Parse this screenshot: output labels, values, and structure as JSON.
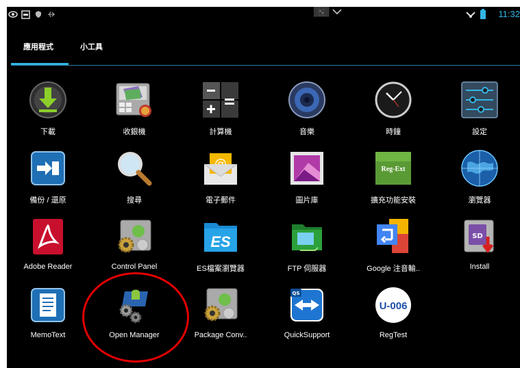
{
  "status_bar": {
    "time": "11:32",
    "icons": [
      "eye-icon",
      "window-icon",
      "shield-icon",
      "usb-icon",
      "screen-toggle-icon",
      "wifi-icon",
      "battery-icon"
    ]
  },
  "tabs": [
    {
      "label": "應用程式",
      "selected": true
    },
    {
      "label": "小工具",
      "selected": false
    }
  ],
  "accent_color": "#33b5e5",
  "highlight_color": "#e30000",
  "apps": [
    {
      "label": "下載",
      "icon": "download-icon"
    },
    {
      "label": "收銀機",
      "icon": "cash-register-icon"
    },
    {
      "label": "計算機",
      "icon": "calculator-icon"
    },
    {
      "label": "音樂",
      "icon": "music-icon"
    },
    {
      "label": "時鐘",
      "icon": "clock-icon"
    },
    {
      "label": "設定",
      "icon": "settings-icon"
    },
    {
      "label": "備份 / 還原",
      "icon": "backup-icon"
    },
    {
      "label": "搜尋",
      "icon": "search-icon"
    },
    {
      "label": "電子郵件",
      "icon": "email-icon"
    },
    {
      "label": "圖片庫",
      "icon": "gallery-icon"
    },
    {
      "label": "擴充功能安裝",
      "icon": "reg-ext-icon",
      "icon_text": "Reg-Ext"
    },
    {
      "label": "瀏覽器",
      "icon": "browser-icon"
    },
    {
      "label": "Adobe Reader",
      "icon": "adobe-reader-icon"
    },
    {
      "label": "Control Panel",
      "icon": "control-panel-icon"
    },
    {
      "label": "ES檔案瀏覽器",
      "icon": "es-file-explorer-icon"
    },
    {
      "label": "FTP 伺服器",
      "icon": "ftp-server-icon"
    },
    {
      "label": "Google 注音輸..",
      "icon": "google-zhuyin-icon"
    },
    {
      "label": "Install",
      "icon": "install-icon",
      "icon_text": "SD"
    },
    {
      "label": "MemoText",
      "icon": "memotext-icon"
    },
    {
      "label": "Open Manager",
      "icon": "open-manager-icon",
      "highlighted": true
    },
    {
      "label": "Package Conv..",
      "icon": "package-converter-icon"
    },
    {
      "label": "QuickSupport",
      "icon": "quicksupport-icon",
      "icon_text": "QS"
    },
    {
      "label": "RegTest",
      "icon": "regtest-icon",
      "icon_text": "U-006"
    }
  ]
}
